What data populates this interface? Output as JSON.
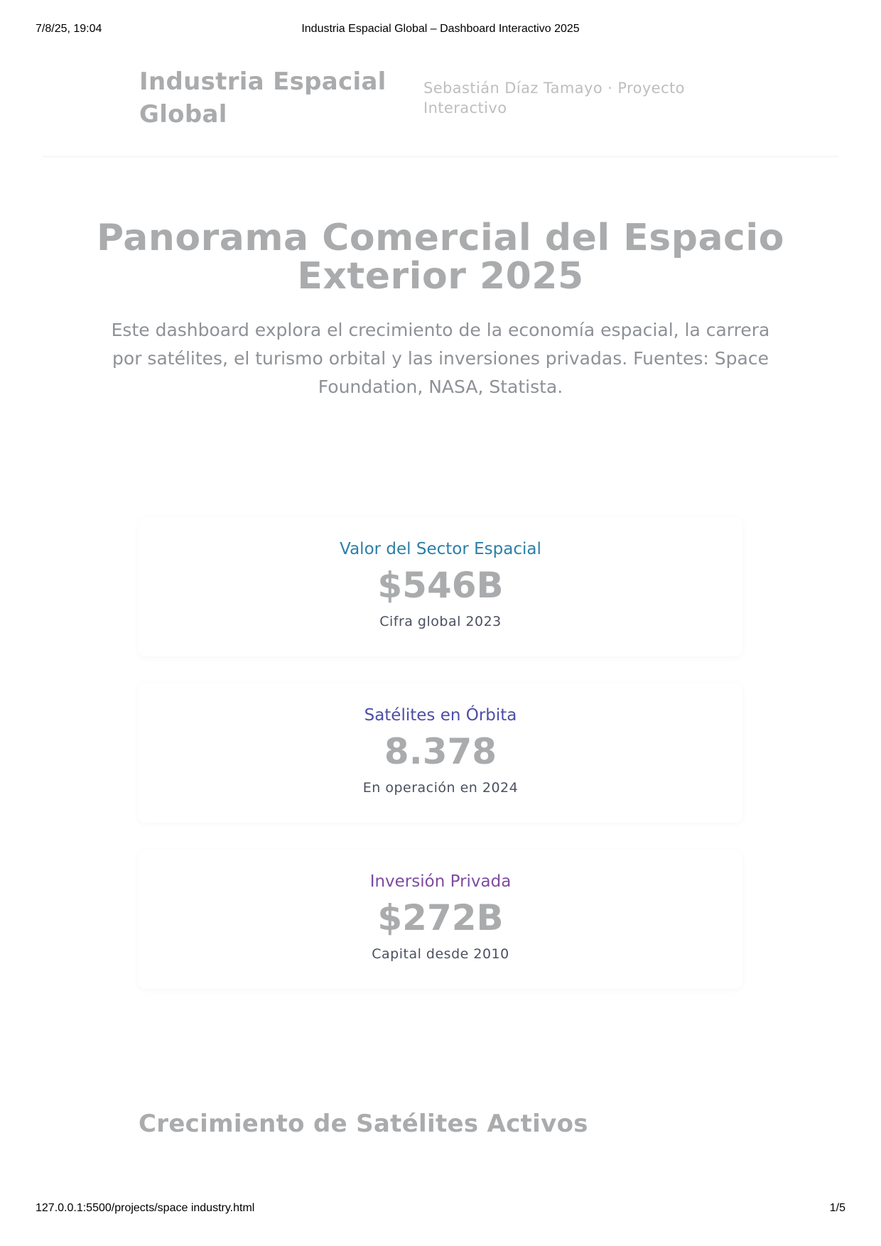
{
  "print": {
    "datetime": "7/8/25, 19:04",
    "title": "Industria Espacial Global – Dashboard Interactivo 2025",
    "url": "127.0.0.1:5500/projects/space industry.html",
    "page_number": "1/5"
  },
  "header": {
    "brand": "Industria Espacial Global",
    "byline": "Sebastián Díaz Tamayo · Proyecto Interactivo"
  },
  "hero": {
    "title": "Panorama Comercial del Espacio Exterior 2025",
    "text": "Este dashboard explora el crecimiento de la economía espacial, la carrera por satélites, el turismo orbital y las inversiones privadas. Fuentes: Space Foundation, NASA, Statista."
  },
  "stats": [
    {
      "title": "Valor del Sector Espacial",
      "value": "$546B",
      "subtitle": "Cifra global 2023",
      "title_color": "#2a7fa8"
    },
    {
      "title": "Satélites en Órbita",
      "value": "8.378",
      "subtitle": "En operación en 2024",
      "title_color": "#4c4fa6"
    },
    {
      "title": "Inversión Privada",
      "value": "$272B",
      "subtitle": "Capital desde 2010",
      "title_color": "#7d4ba3"
    }
  ],
  "section": {
    "title": "Crecimiento de Satélites Activos"
  }
}
